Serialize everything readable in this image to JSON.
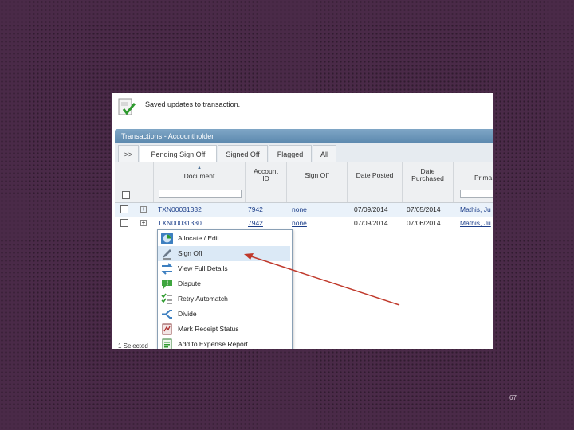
{
  "notice": {
    "text": "Saved updates to transaction."
  },
  "panel": {
    "title": "Transactions - Accountholder"
  },
  "tabs": [
    ">>",
    "Pending Sign Off",
    "Signed Off",
    "Flagged",
    "All"
  ],
  "columns": {
    "document": "Document",
    "account_id_line1": "Account",
    "account_id_line2": "ID",
    "sign_off": "Sign Off",
    "date_posted": "Date Posted",
    "date_purchased_line1": "Date",
    "date_purchased_line2": "Purchased",
    "primary": "Prima"
  },
  "rows": [
    {
      "document": "TXN00031332",
      "account_id": "7942",
      "sign_off": "none",
      "date_posted": "07/09/2014",
      "date_purchased": "07/05/2014",
      "primary": "Mathis, Ju"
    },
    {
      "document": "TXN00031330",
      "account_id": "7942",
      "sign_off": "none",
      "date_posted": "07/09/2014",
      "date_purchased": "07/06/2014",
      "primary": "Mathis, Ju"
    }
  ],
  "context_menu": [
    {
      "label": "Allocate / Edit",
      "icon": "pie-chart-icon"
    },
    {
      "label": "Sign Off",
      "icon": "pen-icon"
    },
    {
      "label": "View Full Details",
      "icon": "transfer-arrows-icon"
    },
    {
      "label": "Dispute",
      "icon": "speech-bubble-icon"
    },
    {
      "label": "Retry Automatch",
      "icon": "checklist-icon"
    },
    {
      "label": "Divide",
      "icon": "split-icon"
    },
    {
      "label": "Mark Receipt Status",
      "icon": "receipt-icon"
    },
    {
      "label": "Add to Expense Report",
      "icon": "report-icon"
    }
  ],
  "footer": {
    "selected_text": "1 Selected"
  },
  "page_number": "67",
  "colors": {
    "accent": "#5b88ae",
    "link": "#1d3f8a",
    "highlight": "#dbe9f6",
    "arrow": "#c0392b"
  }
}
